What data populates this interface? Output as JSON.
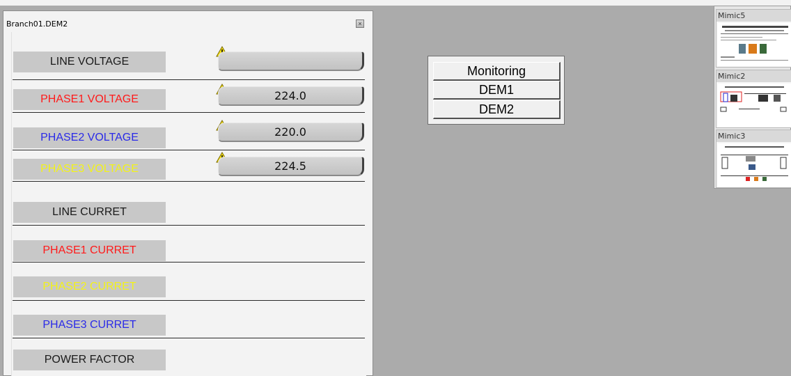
{
  "window": {
    "title": "Branch01.DEM2",
    "close_glyph": "×"
  },
  "rows": [
    {
      "label": "LINE VOLTAGE",
      "color": "#1a1a1a",
      "value": "",
      "warning": true
    },
    {
      "label": "PHASE1 VOLTAGE",
      "color": "#ff1a1a",
      "value": "224.0",
      "warning": true
    },
    {
      "label": "PHASE2 VOLTAGE",
      "color": "#2a2ae8",
      "value": "220.0",
      "warning": true
    },
    {
      "label": "PHASE3 VOLTAGE",
      "color": "#f2f21a",
      "value": "224.5",
      "warning": true
    },
    {
      "label": "LINE CURRET",
      "color": "#1a1a1a",
      "value": null,
      "warning": false
    },
    {
      "label": "PHASE1 CURRET",
      "color": "#ff1a1a",
      "value": null,
      "warning": false
    },
    {
      "label": "PHASE2 CURRET",
      "color": "#f2f21a",
      "value": null,
      "warning": false
    },
    {
      "label": "PHASE3 CURRET",
      "color": "#2a2ae8",
      "value": null,
      "warning": false
    },
    {
      "label": "POWER FACTOR",
      "color": "#1a1a1a",
      "value": null,
      "warning": false
    }
  ],
  "monitoring": {
    "buttons": [
      "Monitoring",
      "DEM1",
      "DEM2"
    ]
  },
  "thumbnails": [
    {
      "title": "Mimic5"
    },
    {
      "title": "Mimic2"
    },
    {
      "title": "Mimic3"
    }
  ],
  "icons": {
    "warning": "warning-triangle-icon",
    "close": "close-icon"
  }
}
